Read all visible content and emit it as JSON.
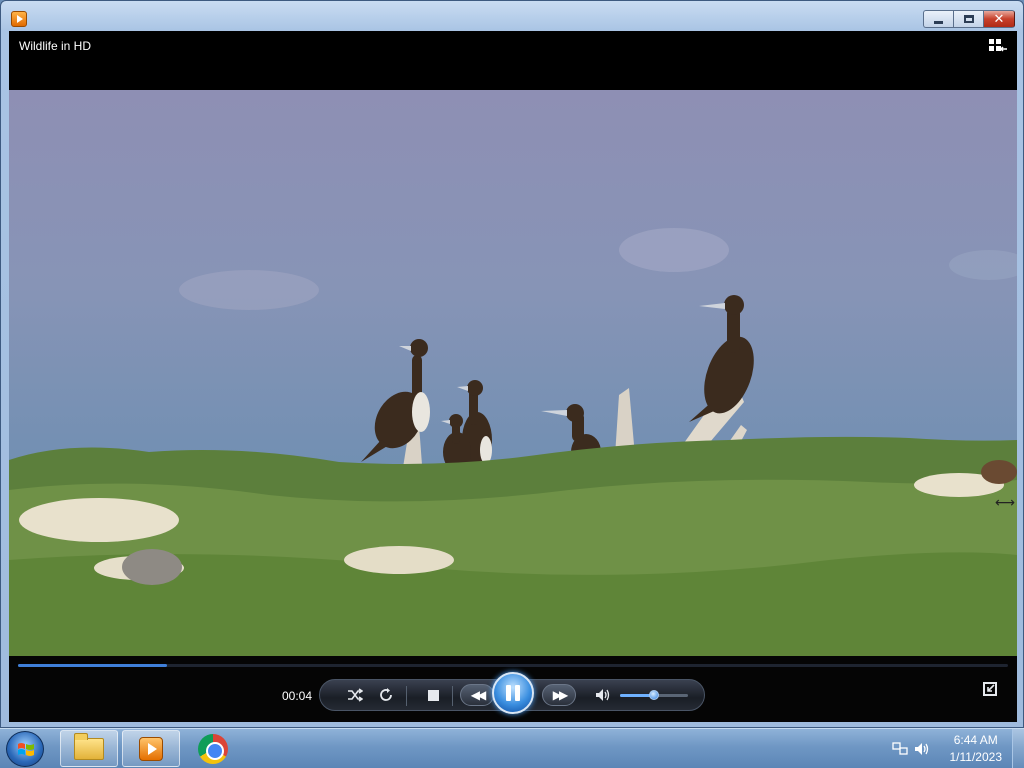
{
  "window": {
    "app_icon": "media-player-icon",
    "buttons": {
      "minimize": "minimize-icon",
      "maximize": "maximize-icon",
      "close_label": "✕"
    }
  },
  "player": {
    "title": "Wildlife in HD",
    "switch_library_icon": "switch-to-library-icon"
  },
  "controls": {
    "elapsed": "00:04",
    "progress_fraction": 0.15,
    "volume_fraction": 0.5,
    "shuffle_icon": "shuffle-icon",
    "repeat_icon": "repeat-icon",
    "stop_icon": "stop-icon",
    "previous_icon": "rewind-icon",
    "play_pause_icon": "pause-icon",
    "next_icon": "fast-forward-icon",
    "mute_icon": "speaker-icon",
    "fullscreen_icon": "fullscreen-icon"
  },
  "taskbar": {
    "start": "windows-logo-icon",
    "apps": [
      "file-explorer-icon",
      "media-player-icon",
      "chrome-icon"
    ],
    "tray": [
      "network-icon",
      "volume-icon"
    ],
    "time": "6:44 AM",
    "date": "1/11/2023"
  },
  "colors": {
    "accent": "#3f7fd8",
    "player_bg": "#000000",
    "taskbar": "#6f97c4"
  }
}
